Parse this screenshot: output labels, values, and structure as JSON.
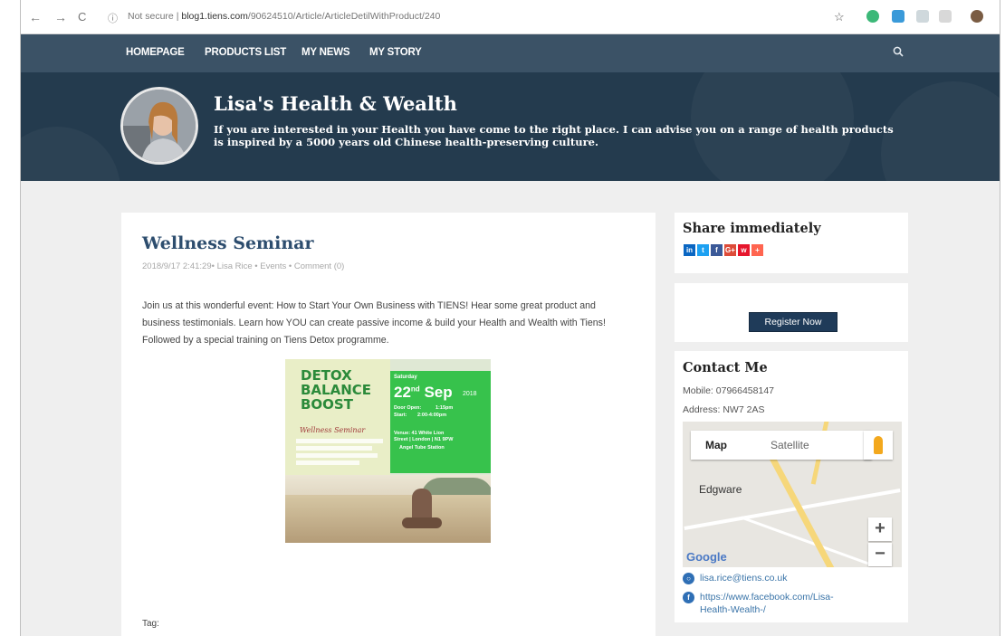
{
  "browser": {
    "back": "←",
    "forward": "→",
    "reload": "C",
    "security": "Not secure",
    "separator": "|",
    "host": "blog1.tiens.com",
    "path": "/90624510/Article/ArticleDetilWithProduct/240",
    "star": "☆"
  },
  "nav": {
    "items": [
      "HOMEPAGE",
      "PRODUCTS LIST",
      "MY NEWS",
      "MY STORY"
    ],
    "search_icon": "search-icon"
  },
  "hero": {
    "title": "Lisa's Health & Wealth",
    "description": "If you are interested in your Health you have come to the right place. I can advise you on a range of health products is inspired by a 5000 years old Chinese health-preserving culture."
  },
  "article": {
    "title": "Wellness Seminar",
    "meta": "2018/9/17 2:41:29• Lisa Rice • Events • Comment (0)",
    "body": "Join us at this wonderful event: How to Start Your Own Business with TIENS! Hear some great product and business testimonials. Learn how YOU can create passive income & build your Health and Wealth with Tiens! Followed by a special training on Tiens Detox programme.",
    "tag_label": "Tag:",
    "poster": {
      "line1": "DETOX",
      "line2": "BALANCE",
      "line3": "BOOST",
      "subtitle": "Wellness Seminar",
      "day": "Saturday",
      "date": "22",
      "date_suffix": "nd",
      "month": "Sep",
      "year": "2018",
      "doors": "Door Open:",
      "doors_time": "1:15pm",
      "start": "Start:",
      "start_time": "2:00-4:00pm",
      "venue": "Venue: 41 White Lion",
      "venue2": "Street | London | N1 9PW",
      "station": "Angel Tube Station"
    }
  },
  "sidebar": {
    "share_title": "Share immediately",
    "share_icons": [
      {
        "label": "in",
        "color": "#0a66c2",
        "name": "linkedin-icon"
      },
      {
        "label": "t",
        "color": "#1da1f2",
        "name": "twitter-icon"
      },
      {
        "label": "f",
        "color": "#3b5998",
        "name": "facebook-icon"
      },
      {
        "label": "G+",
        "color": "#dd4b39",
        "name": "google-plus-icon"
      },
      {
        "label": "w",
        "color": "#e6162d",
        "name": "weibo-icon"
      },
      {
        "label": "+",
        "color": "#ff6550",
        "name": "more-share-icon"
      }
    ],
    "register_label": "Register Now",
    "contact_title": "Contact Me",
    "mobile": "Mobile: 07966458147",
    "address": "Address: NW7 2AS",
    "map": {
      "tab_map": "Map",
      "tab_satellite": "Satellite",
      "place": "Edgware",
      "zoom_in": "+",
      "zoom_out": "−",
      "logo": "Google"
    },
    "email": "lisa.rice@tiens.co.uk",
    "facebook_line1": "https://www.facebook.com/Lisa-",
    "facebook_line2": "Health-Wealth-/"
  },
  "colors": {
    "nav_bg": "#3b5266",
    "hero_bg": "#243b4e",
    "title_color": "#2d4d6e",
    "button_bg": "#1f3b59"
  }
}
